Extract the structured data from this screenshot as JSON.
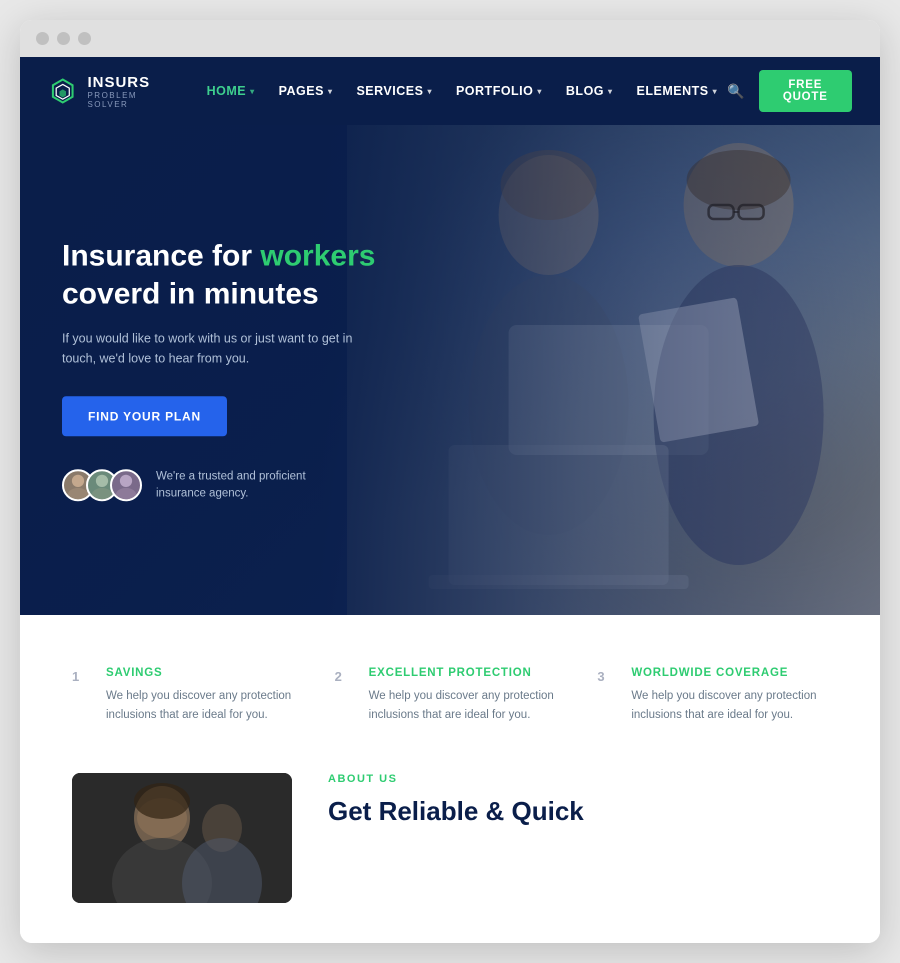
{
  "browser": {
    "dots": [
      "dot1",
      "dot2",
      "dot3"
    ]
  },
  "navbar": {
    "logo_name": "INSURS",
    "logo_tagline": "PROBLEM SOLVER",
    "nav_items": [
      {
        "label": "HOME",
        "active": true,
        "has_dropdown": true
      },
      {
        "label": "PAGES",
        "active": false,
        "has_dropdown": true
      },
      {
        "label": "SERVICES",
        "active": false,
        "has_dropdown": true
      },
      {
        "label": "PORTFOLIO",
        "active": false,
        "has_dropdown": true
      },
      {
        "label": "BLOG",
        "active": false,
        "has_dropdown": true
      },
      {
        "label": "ELEMENTS",
        "active": false,
        "has_dropdown": true
      }
    ],
    "free_quote_label": "FREE QUOTE"
  },
  "hero": {
    "title_part1": "Insurance for ",
    "title_highlight": "workers",
    "title_part2": "coverd in minutes",
    "subtitle": "If you would like to work with us or just want to get in touch, we'd love to hear from you.",
    "cta_label": "FIND YOUR PLAN",
    "trust_text": "We're a trusted and proficient insurance agency."
  },
  "features": [
    {
      "number": "1",
      "title": "SAVINGS",
      "description": "We help you discover any protection inclusions that are ideal for you."
    },
    {
      "number": "2",
      "title": "EXCELLENT PROTECTION",
      "description": "We help you discover any protection inclusions that are ideal for you."
    },
    {
      "number": "3",
      "title": "WORLDWIDE COVERAGE",
      "description": "We help you discover any protection inclusions that are ideal for you."
    }
  ],
  "about": {
    "label": "ABOUT US",
    "title": "Get Reliable & Quick"
  },
  "colors": {
    "green_accent": "#2ecc71",
    "dark_navy": "#0a1e4a",
    "blue_btn": "#2563eb"
  }
}
